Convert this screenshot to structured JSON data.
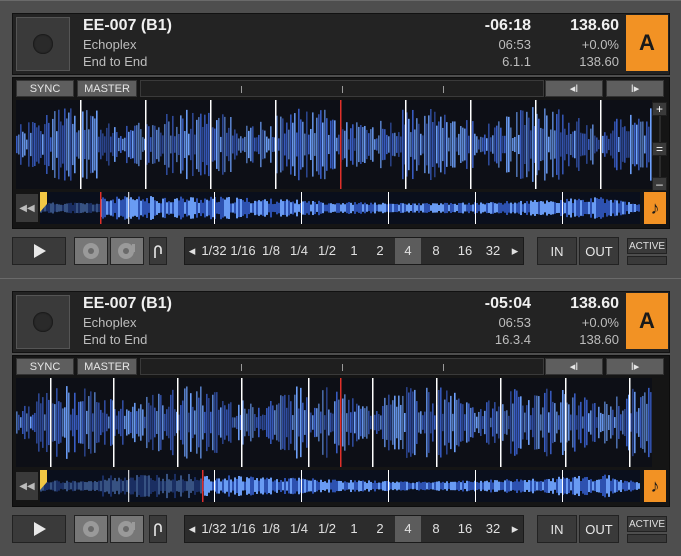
{
  "icons": {
    "play": "play-icon",
    "cue": "cue-disc-icon",
    "cup": "cup-icon",
    "flux": "flux-icon",
    "rewind": "rewind-icon",
    "note": "note-icon"
  },
  "colors": {
    "accent": "#f29224",
    "wave_low": "#3a5fc8",
    "wave_high": "#6fa3ff",
    "beat_marker": "#ffffff",
    "play_marker": "#e0302a"
  },
  "decks": [
    {
      "letter": "A",
      "title": "EE-007 (B1)",
      "artist": "Echoplex",
      "album": "End to End",
      "remaining": "-06:18",
      "length": "06:53",
      "position": "6.1.1",
      "bpm": "138.60",
      "pitch": "+0.0%",
      "bpm2": "138.60",
      "sync_label": "SYNC",
      "master_label": "MASTER",
      "beatjump_back": "◂I",
      "beatjump_fwd": "I▸",
      "zoom_in": "+",
      "zoom_mid": "=",
      "zoom_out": "–",
      "progress": 0.1
    },
    {
      "letter": "A",
      "title": "EE-007 (B1)",
      "artist": "Echoplex",
      "album": "End to End",
      "remaining": "-05:04",
      "length": "06:53",
      "position": "16.3.4",
      "bpm": "138.60",
      "pitch": "+0.0%",
      "bpm2": "138.60",
      "sync_label": "SYNC",
      "master_label": "MASTER",
      "beatjump_back": "◂I",
      "beatjump_fwd": "I▸",
      "zoom_in": "+",
      "zoom_mid": "=",
      "zoom_out": "–",
      "progress": 0.27
    }
  ],
  "transport": {
    "loop_sizes": [
      "1/32",
      "1/16",
      "1/8",
      "1/4",
      "1/2",
      "1",
      "2",
      "4",
      "8",
      "16",
      "32"
    ],
    "selected_loop": "4",
    "in_label": "IN",
    "out_label": "OUT",
    "active_label": "ACTIVE",
    "loop_prev": "◂",
    "loop_next": "▸"
  }
}
